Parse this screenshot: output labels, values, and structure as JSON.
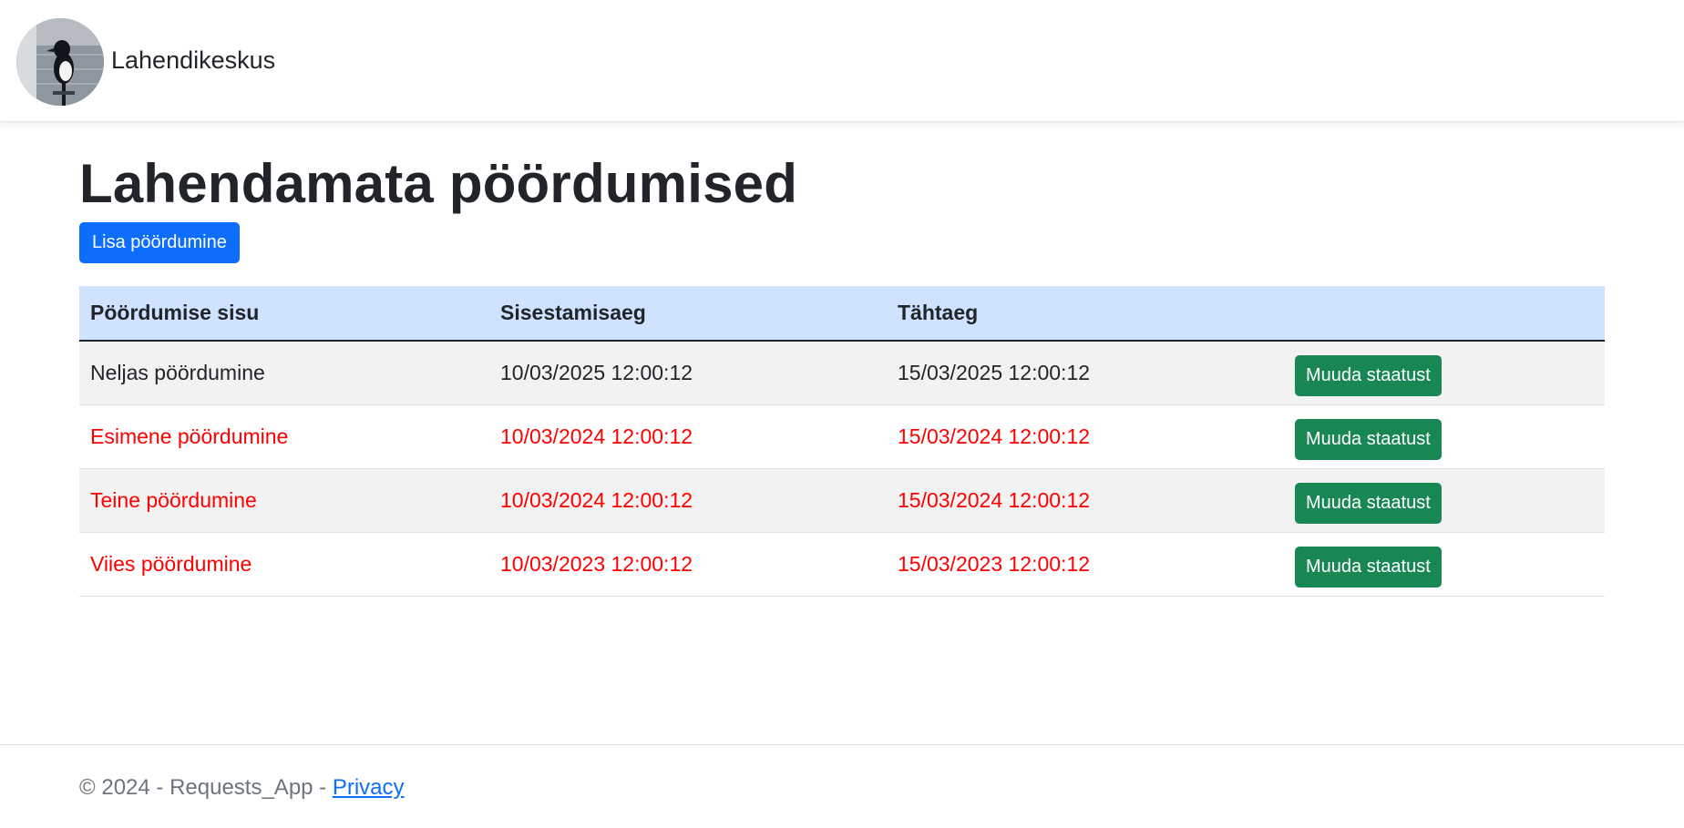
{
  "header": {
    "brand": "Lahendikeskus",
    "logo_icon": "magpie-bird-photo"
  },
  "main": {
    "title": "Lahendamata pöördumised",
    "add_button_label": "Lisa pöördumine",
    "table": {
      "columns": [
        "Pöördumise sisu",
        "Sisestamisaeg",
        "Tähtaeg",
        ""
      ],
      "rows": [
        {
          "content": "Neljas pöördumine",
          "entered": "10/03/2025 12:00:12",
          "deadline": "15/03/2025 12:00:12",
          "action": "Muuda staatust",
          "overdue": false
        },
        {
          "content": "Esimene pöördumine",
          "entered": "10/03/2024 12:00:12",
          "deadline": "15/03/2024 12:00:12",
          "action": "Muuda staatust",
          "overdue": true
        },
        {
          "content": "Teine pöördumine",
          "entered": "10/03/2024 12:00:12",
          "deadline": "15/03/2024 12:00:12",
          "action": "Muuda staatust",
          "overdue": true
        },
        {
          "content": "Viies pöördumine",
          "entered": "10/03/2023 12:00:12",
          "deadline": "15/03/2023 12:00:12",
          "action": "Muuda staatust",
          "overdue": true
        }
      ]
    }
  },
  "footer": {
    "text": "© 2024 - Requests_App - ",
    "privacy_link": "Privacy"
  },
  "colors": {
    "primary": "#0d6efd",
    "success": "#198754",
    "overdue": "#ff0000",
    "table_header": "#cfe2ff"
  }
}
